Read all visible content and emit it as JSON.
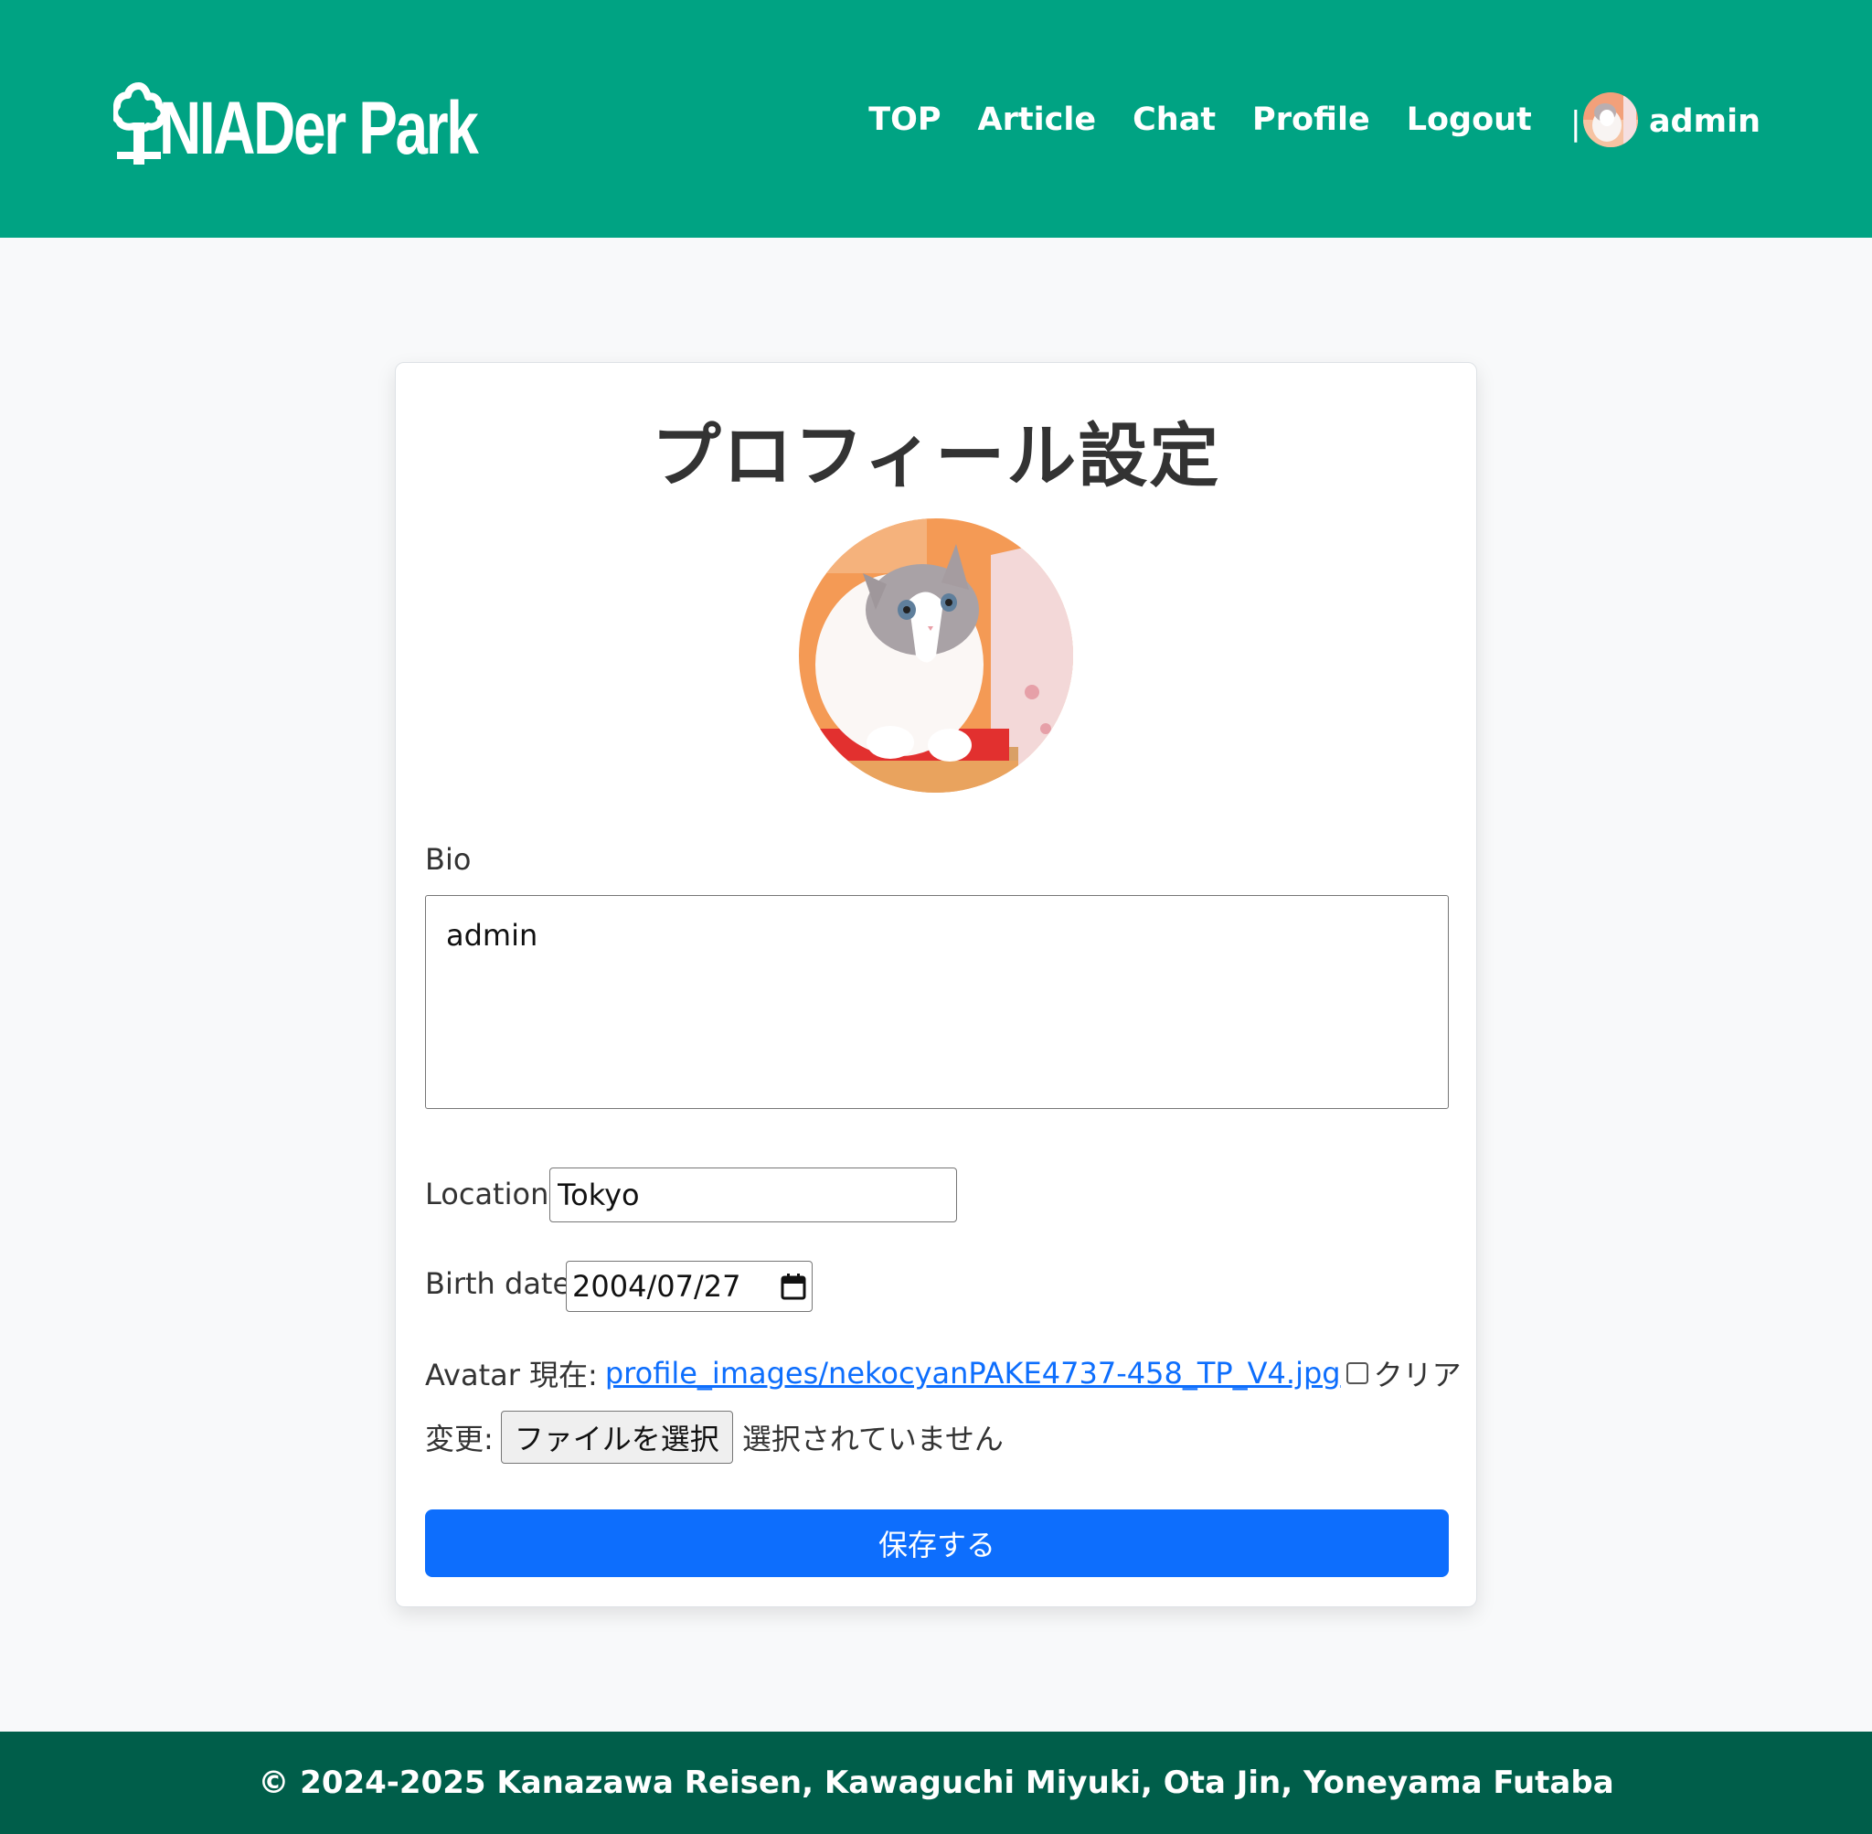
{
  "brand": {
    "logo_text": "NIADer Park",
    "color": "#00a383",
    "footer_color": "#005e4a"
  },
  "nav": {
    "items": [
      {
        "label": "TOP"
      },
      {
        "label": "Article"
      },
      {
        "label": "Chat"
      },
      {
        "label": "Profile"
      },
      {
        "label": "Logout"
      }
    ],
    "separator": "|",
    "user": "admin"
  },
  "form": {
    "title": "プロフィール設定",
    "bio_label": "Bio",
    "bio_value": "admin",
    "location_label": "Location",
    "location_value": "Tokyo",
    "birthdate_label": "Birth date",
    "birthdate_value": "2004/07/27",
    "avatar_label": "Avatar 現在:",
    "avatar_path": "profile_images/nekocyanPAKE4737-458_TP_V4.jpg",
    "clear_label": "クリア",
    "change_label": "変更:",
    "file_button": "ファイルを選択",
    "file_status": "選択されていません",
    "save_button": "保存する",
    "accent": "#0d6efd"
  },
  "footer": {
    "text": "© 2024-2025 Kanazawa Reisen, Kawaguchi Miyuki, Ota Jin, Yoneyama Futaba"
  }
}
